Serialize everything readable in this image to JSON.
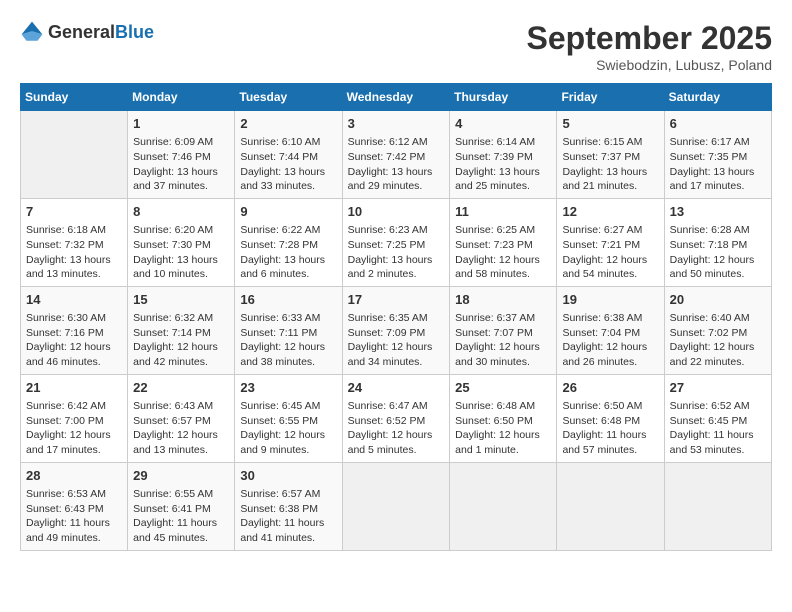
{
  "logo": {
    "general": "General",
    "blue": "Blue"
  },
  "title": {
    "month": "September 2025",
    "location": "Swiebodzin, Lubusz, Poland"
  },
  "days_of_week": [
    "Sunday",
    "Monday",
    "Tuesday",
    "Wednesday",
    "Thursday",
    "Friday",
    "Saturday"
  ],
  "weeks": [
    [
      {
        "day": "",
        "content": ""
      },
      {
        "day": "1",
        "content": "Sunrise: 6:09 AM\nSunset: 7:46 PM\nDaylight: 13 hours and 37 minutes."
      },
      {
        "day": "2",
        "content": "Sunrise: 6:10 AM\nSunset: 7:44 PM\nDaylight: 13 hours and 33 minutes."
      },
      {
        "day": "3",
        "content": "Sunrise: 6:12 AM\nSunset: 7:42 PM\nDaylight: 13 hours and 29 minutes."
      },
      {
        "day": "4",
        "content": "Sunrise: 6:14 AM\nSunset: 7:39 PM\nDaylight: 13 hours and 25 minutes."
      },
      {
        "day": "5",
        "content": "Sunrise: 6:15 AM\nSunset: 7:37 PM\nDaylight: 13 hours and 21 minutes."
      },
      {
        "day": "6",
        "content": "Sunrise: 6:17 AM\nSunset: 7:35 PM\nDaylight: 13 hours and 17 minutes."
      }
    ],
    [
      {
        "day": "7",
        "content": "Sunrise: 6:18 AM\nSunset: 7:32 PM\nDaylight: 13 hours and 13 minutes."
      },
      {
        "day": "8",
        "content": "Sunrise: 6:20 AM\nSunset: 7:30 PM\nDaylight: 13 hours and 10 minutes."
      },
      {
        "day": "9",
        "content": "Sunrise: 6:22 AM\nSunset: 7:28 PM\nDaylight: 13 hours and 6 minutes."
      },
      {
        "day": "10",
        "content": "Sunrise: 6:23 AM\nSunset: 7:25 PM\nDaylight: 13 hours and 2 minutes."
      },
      {
        "day": "11",
        "content": "Sunrise: 6:25 AM\nSunset: 7:23 PM\nDaylight: 12 hours and 58 minutes."
      },
      {
        "day": "12",
        "content": "Sunrise: 6:27 AM\nSunset: 7:21 PM\nDaylight: 12 hours and 54 minutes."
      },
      {
        "day": "13",
        "content": "Sunrise: 6:28 AM\nSunset: 7:18 PM\nDaylight: 12 hours and 50 minutes."
      }
    ],
    [
      {
        "day": "14",
        "content": "Sunrise: 6:30 AM\nSunset: 7:16 PM\nDaylight: 12 hours and 46 minutes."
      },
      {
        "day": "15",
        "content": "Sunrise: 6:32 AM\nSunset: 7:14 PM\nDaylight: 12 hours and 42 minutes."
      },
      {
        "day": "16",
        "content": "Sunrise: 6:33 AM\nSunset: 7:11 PM\nDaylight: 12 hours and 38 minutes."
      },
      {
        "day": "17",
        "content": "Sunrise: 6:35 AM\nSunset: 7:09 PM\nDaylight: 12 hours and 34 minutes."
      },
      {
        "day": "18",
        "content": "Sunrise: 6:37 AM\nSunset: 7:07 PM\nDaylight: 12 hours and 30 minutes."
      },
      {
        "day": "19",
        "content": "Sunrise: 6:38 AM\nSunset: 7:04 PM\nDaylight: 12 hours and 26 minutes."
      },
      {
        "day": "20",
        "content": "Sunrise: 6:40 AM\nSunset: 7:02 PM\nDaylight: 12 hours and 22 minutes."
      }
    ],
    [
      {
        "day": "21",
        "content": "Sunrise: 6:42 AM\nSunset: 7:00 PM\nDaylight: 12 hours and 17 minutes."
      },
      {
        "day": "22",
        "content": "Sunrise: 6:43 AM\nSunset: 6:57 PM\nDaylight: 12 hours and 13 minutes."
      },
      {
        "day": "23",
        "content": "Sunrise: 6:45 AM\nSunset: 6:55 PM\nDaylight: 12 hours and 9 minutes."
      },
      {
        "day": "24",
        "content": "Sunrise: 6:47 AM\nSunset: 6:52 PM\nDaylight: 12 hours and 5 minutes."
      },
      {
        "day": "25",
        "content": "Sunrise: 6:48 AM\nSunset: 6:50 PM\nDaylight: 12 hours and 1 minute."
      },
      {
        "day": "26",
        "content": "Sunrise: 6:50 AM\nSunset: 6:48 PM\nDaylight: 11 hours and 57 minutes."
      },
      {
        "day": "27",
        "content": "Sunrise: 6:52 AM\nSunset: 6:45 PM\nDaylight: 11 hours and 53 minutes."
      }
    ],
    [
      {
        "day": "28",
        "content": "Sunrise: 6:53 AM\nSunset: 6:43 PM\nDaylight: 11 hours and 49 minutes."
      },
      {
        "day": "29",
        "content": "Sunrise: 6:55 AM\nSunset: 6:41 PM\nDaylight: 11 hours and 45 minutes."
      },
      {
        "day": "30",
        "content": "Sunrise: 6:57 AM\nSunset: 6:38 PM\nDaylight: 11 hours and 41 minutes."
      },
      {
        "day": "",
        "content": ""
      },
      {
        "day": "",
        "content": ""
      },
      {
        "day": "",
        "content": ""
      },
      {
        "day": "",
        "content": ""
      }
    ]
  ]
}
